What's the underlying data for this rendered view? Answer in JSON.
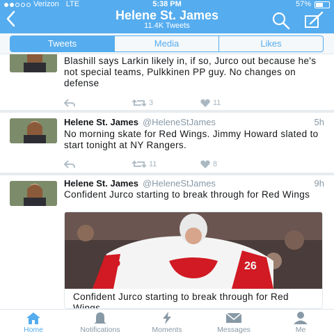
{
  "status_bar": {
    "carrier": "Verizon",
    "network": "LTE",
    "time": "5:38 PM",
    "battery": "57%",
    "battery_level": 0.57
  },
  "header": {
    "back_icon": "chevron-left-icon",
    "title": "Helene St. James",
    "subtitle": "11.4K Tweets",
    "search_icon": "search-icon",
    "compose_icon": "compose-icon"
  },
  "segments": {
    "items": [
      {
        "label": "Tweets",
        "active": true
      },
      {
        "label": "Media",
        "active": false
      },
      {
        "label": "Likes",
        "active": false
      }
    ]
  },
  "tweets": [
    {
      "name": "",
      "handle": "",
      "time": "",
      "text": "Blashill says Larkin likely in, if so, Jurco out because he's not special teams, Pulkkinen PP guy. No changes on defense",
      "retweets": "3",
      "likes": "11"
    },
    {
      "name": "Helene St. James",
      "handle": "@HeleneStJames",
      "time": "5h",
      "text": "No morning skate for Red Wings. Jimmy Howard slated to start tonight at NY Rangers.",
      "retweets": "11",
      "likes": "8"
    },
    {
      "name": "Helene St. James",
      "handle": "@HeleneStJames",
      "time": "9h",
      "text": "Confident Jurco starting to break through for Red Wings",
      "card_title": "Confident Jurco starting to break through for Red Wings"
    }
  ],
  "tabbar": {
    "items": [
      {
        "label": "Home",
        "icon": "home-icon",
        "active": true
      },
      {
        "label": "Notifications",
        "icon": "bell-icon",
        "active": false
      },
      {
        "label": "Moments",
        "icon": "lightning-icon",
        "active": false
      },
      {
        "label": "Messages",
        "icon": "envelope-icon",
        "active": false
      },
      {
        "label": "Me",
        "icon": "person-icon",
        "active": false
      }
    ]
  },
  "colors": {
    "brand": "#55acee",
    "text": "#14171a",
    "muted": "#8899a6"
  }
}
